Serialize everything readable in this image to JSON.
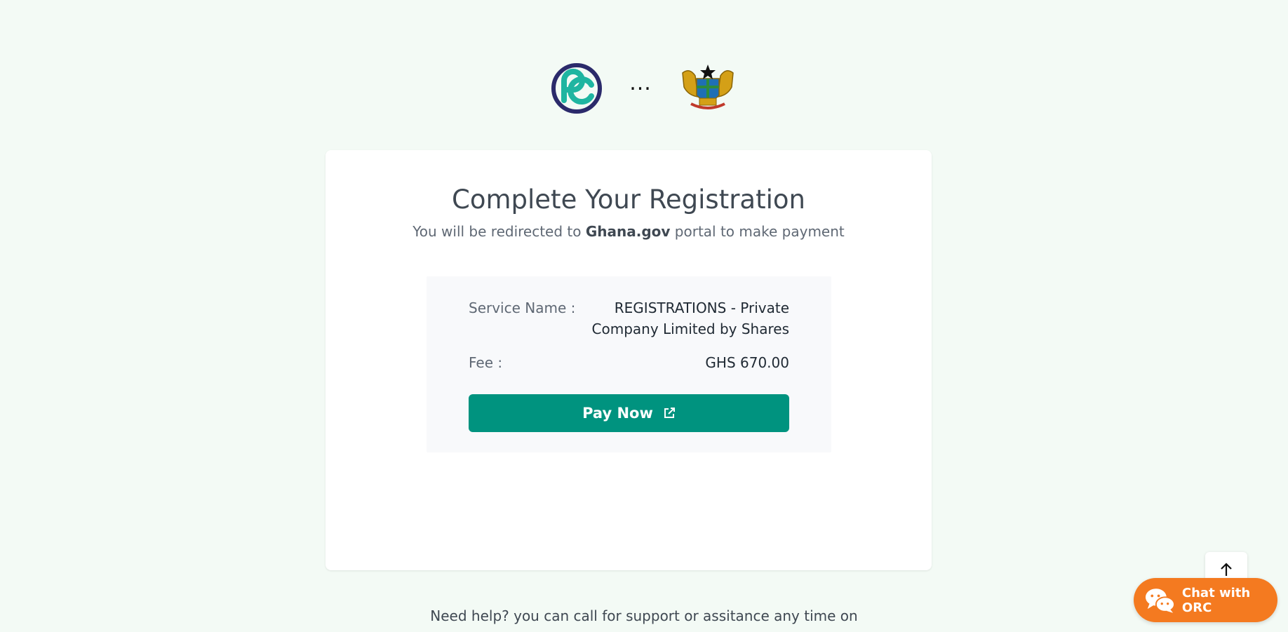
{
  "header": {
    "separator": "...",
    "left_logo_icon": "orc-logo-icon",
    "right_logo_icon": "ghana-coat-of-arms-icon"
  },
  "card": {
    "title": "Complete Your Registration",
    "subtitle_prefix": "You will be redirected to ",
    "subtitle_strong": "Ghana.gov",
    "subtitle_suffix": " portal to make payment",
    "summary": {
      "service_label": "Service Name :",
      "service_value": "REGISTRATIONS - Private Company Limited by Shares",
      "fee_label": "Fee :",
      "fee_value": "GHS 670.00"
    },
    "pay_button_label": "Pay Now",
    "pay_button_icon": "external-link-icon"
  },
  "footer": {
    "help_text": "Need help? you can call for support or assitance any time on"
  },
  "widgets": {
    "scroll_top_icon": "arrow-up-icon",
    "chat_label": "Chat with ORC",
    "chat_icon": "chat-bubbles-icon"
  },
  "colors": {
    "background": "#f3faf5",
    "primary": "#00937f",
    "chat": "#f47a20",
    "logo_teal": "#1fb5a1",
    "logo_navy": "#2b2a6b"
  }
}
